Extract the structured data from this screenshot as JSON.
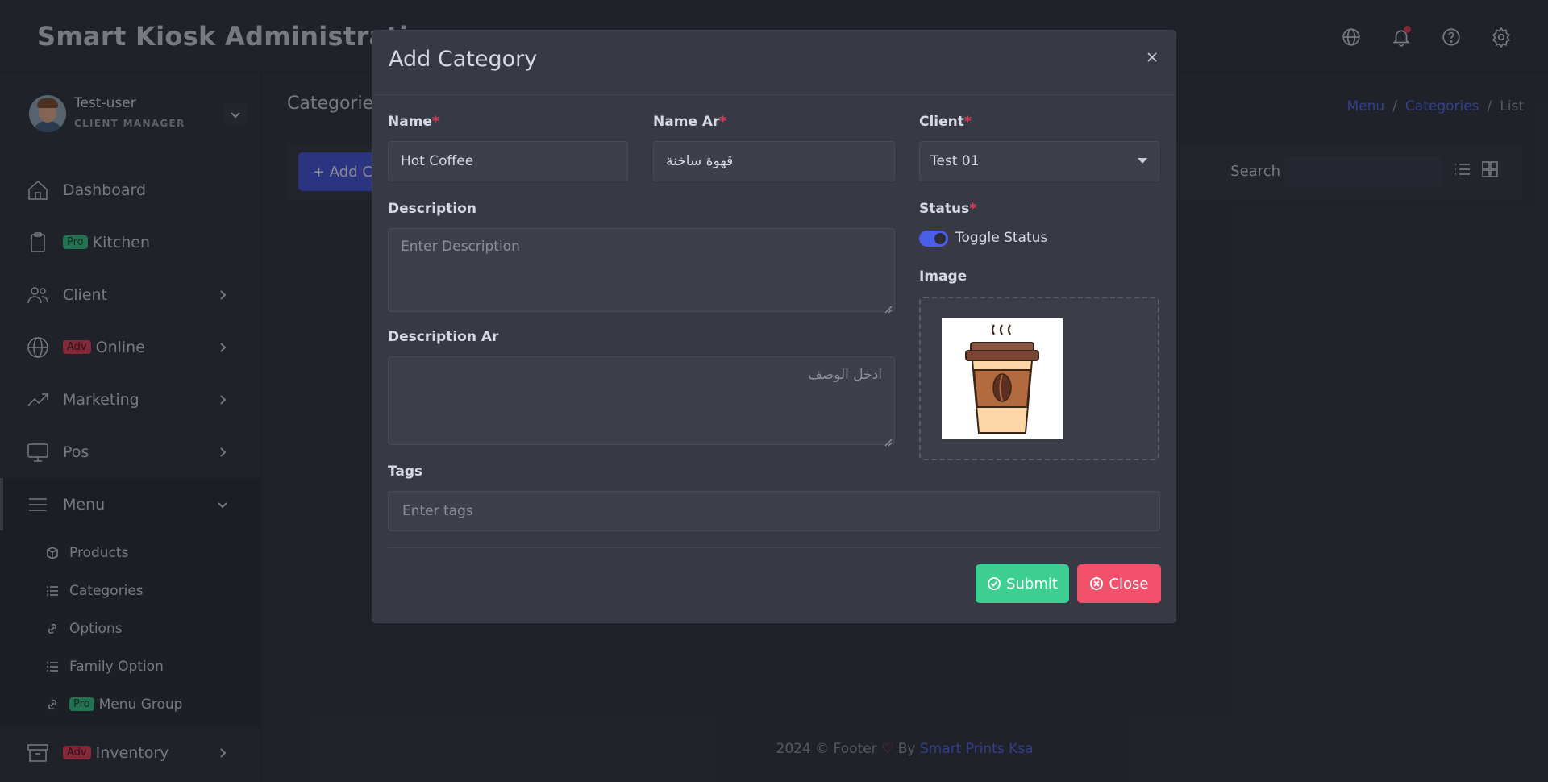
{
  "app": {
    "title": "Smart Kiosk Administration"
  },
  "header_icons": [
    "globe-icon",
    "bell-icon",
    "help-icon",
    "settings-icon"
  ],
  "user": {
    "name": "Test-user",
    "role": "CLIENT MANAGER"
  },
  "sidebar": {
    "items": [
      {
        "label": "Dashboard",
        "icon": "home-icon",
        "badge": ""
      },
      {
        "label": "Kitchen",
        "icon": "clipboard-icon",
        "badge": "Pro"
      },
      {
        "label": "Client",
        "icon": "users-icon",
        "badge": ""
      },
      {
        "label": "Online",
        "icon": "globe-icon",
        "badge": "Adv"
      },
      {
        "label": "Marketing",
        "icon": "trending-up-icon",
        "badge": ""
      },
      {
        "label": "Pos",
        "icon": "monitor-icon",
        "badge": ""
      },
      {
        "label": "Menu",
        "icon": "menu-icon",
        "badge": ""
      },
      {
        "label": "Inventory",
        "icon": "archive-icon",
        "badge": "Adv"
      }
    ],
    "menu_sub_items": [
      {
        "label": "Products",
        "icon": "box-icon",
        "badge": ""
      },
      {
        "label": "Categories",
        "icon": "list-icon",
        "badge": ""
      },
      {
        "label": "Options",
        "icon": "link-icon",
        "badge": ""
      },
      {
        "label": "Family Option",
        "icon": "list-icon",
        "badge": ""
      },
      {
        "label": "Menu Group",
        "icon": "link-icon",
        "badge": "Pro"
      }
    ]
  },
  "page": {
    "heading": "Categories",
    "breadcrumb": [
      "Menu",
      "Categories",
      "List"
    ],
    "add_button": "+ Add C",
    "search_label": "Search"
  },
  "modal": {
    "title": "Add Category",
    "name_label": "Name",
    "name_value": "Hot Coffee",
    "name_ar_label": "Name Ar",
    "name_ar_value": "قهوة ساخنة",
    "client_label": "Client",
    "client_value": "Test 01",
    "description_label": "Description",
    "description_placeholder": "Enter Description",
    "description_ar_label": "Description Ar",
    "description_ar_placeholder": "ادخل الوصف",
    "status_label": "Status",
    "status_enabled": true,
    "toggle_label": "Toggle Status",
    "image_label": "Image",
    "tags_label": "Tags",
    "tags_placeholder": "Enter tags",
    "submit_label": "Submit",
    "close_label": "Close",
    "required_mark": "*"
  },
  "footer": {
    "text": "2024 © Footer",
    "by": "By",
    "brand": "Smart Prints Ksa"
  },
  "colors": {
    "primary": "#3d4fd6",
    "success": "#3ccf91",
    "danger": "#f2516c",
    "link": "#4f63e6"
  }
}
